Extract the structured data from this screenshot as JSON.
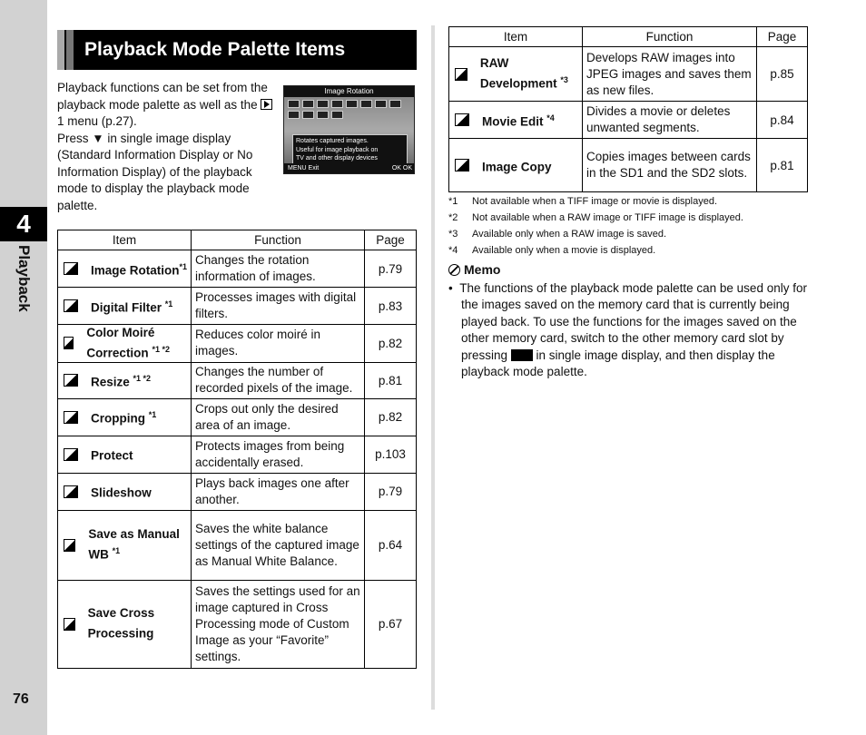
{
  "sidebar": {
    "chapter": "4",
    "label": "Playback",
    "page_number": "76"
  },
  "title": "Playback Mode Palette Items",
  "intro": {
    "p1a": "Playback functions can be set from the playback mode palette as well as the ",
    "p1b": "1 menu (p.27).",
    "p2": "Press ▼ in single image display (Standard Information Display or No Information Display) of the playback mode to display the playback mode palette."
  },
  "screen": {
    "title": "Image Rotation",
    "tip": [
      "Rotates captured images.",
      "Useful for image playback on",
      "TV and other display devices"
    ],
    "exit": "MENU Exit",
    "ok": "OK OK"
  },
  "table_headers": {
    "item": "Item",
    "function": "Function",
    "page": "Page"
  },
  "left_rows": [
    {
      "icon": "image-rotation-icon",
      "item": "Image Rotation",
      "note": "*1",
      "function": "Changes the rotation information of images.",
      "page": "p.79"
    },
    {
      "icon": "digital-filter-icon",
      "item": "Digital Filter ",
      "note": "*1",
      "function": "Processes images with digital filters.",
      "page": "p.83"
    },
    {
      "icon": "color-moire-icon",
      "item": "Color Moiré Correction ",
      "note": "*1 *2",
      "function": "Reduces color moiré in images.",
      "page": "p.82"
    },
    {
      "icon": "resize-icon",
      "item": "Resize ",
      "note": "*1 *2",
      "function": "Changes the number of recorded pixels of the image.",
      "page": "p.81"
    },
    {
      "icon": "cropping-icon",
      "item": "Cropping ",
      "note": "*1",
      "function": "Crops out only the desired area of an image.",
      "page": "p.82"
    },
    {
      "icon": "protect-icon",
      "item": "Protect",
      "note": "",
      "function": "Protects images from being accidentally erased.",
      "page": "p.103"
    },
    {
      "icon": "slideshow-icon",
      "item": "Slideshow",
      "note": "",
      "function": "Plays back images one after another.",
      "page": "p.79"
    },
    {
      "icon": "save-manual-wb-icon",
      "item": "Save as Manual WB ",
      "note": "*1",
      "function": "Saves the white balance settings of the captured image as Manual White Balance.",
      "page": "p.64"
    },
    {
      "icon": "save-cross-processing-icon",
      "item": "Save Cross Processing",
      "note": "",
      "function": "Saves the settings used for an image captured in Cross Processing mode of Custom Image as your “Favorite” settings.",
      "page": "p.67"
    }
  ],
  "right_rows": [
    {
      "icon": "raw-development-icon",
      "item": "RAW Development ",
      "note": "*3",
      "function": "Develops RAW images into JPEG images and saves them as new files.",
      "page": "p.85"
    },
    {
      "icon": "movie-edit-icon",
      "item": "Movie Edit ",
      "note": "*4",
      "function": "Divides a movie or deletes unwanted segments.",
      "page": "p.84"
    },
    {
      "icon": "image-copy-icon",
      "item": "Image Copy",
      "note": "",
      "function": "Copies images between cards in the SD1 and the SD2 slots.",
      "page": "p.81"
    }
  ],
  "footnotes": [
    {
      "mark": "*1",
      "text": "Not available when a TIFF image or movie is displayed."
    },
    {
      "mark": "*2",
      "text": "Not available when a RAW image or TIFF image is displayed."
    },
    {
      "mark": "*3",
      "text": "Available only when a RAW image is saved."
    },
    {
      "mark": "*4",
      "text": "Available only when a movie is displayed."
    }
  ],
  "memo": {
    "title": "Memo",
    "text_a": "The functions of the playback mode palette can be used only for the images saved on the memory card that is currently being played back. To use the functions for the images saved on the other memory card, switch to the other memory card slot by pressing ",
    "text_b": " in single image display, and then display the playback mode palette."
  }
}
